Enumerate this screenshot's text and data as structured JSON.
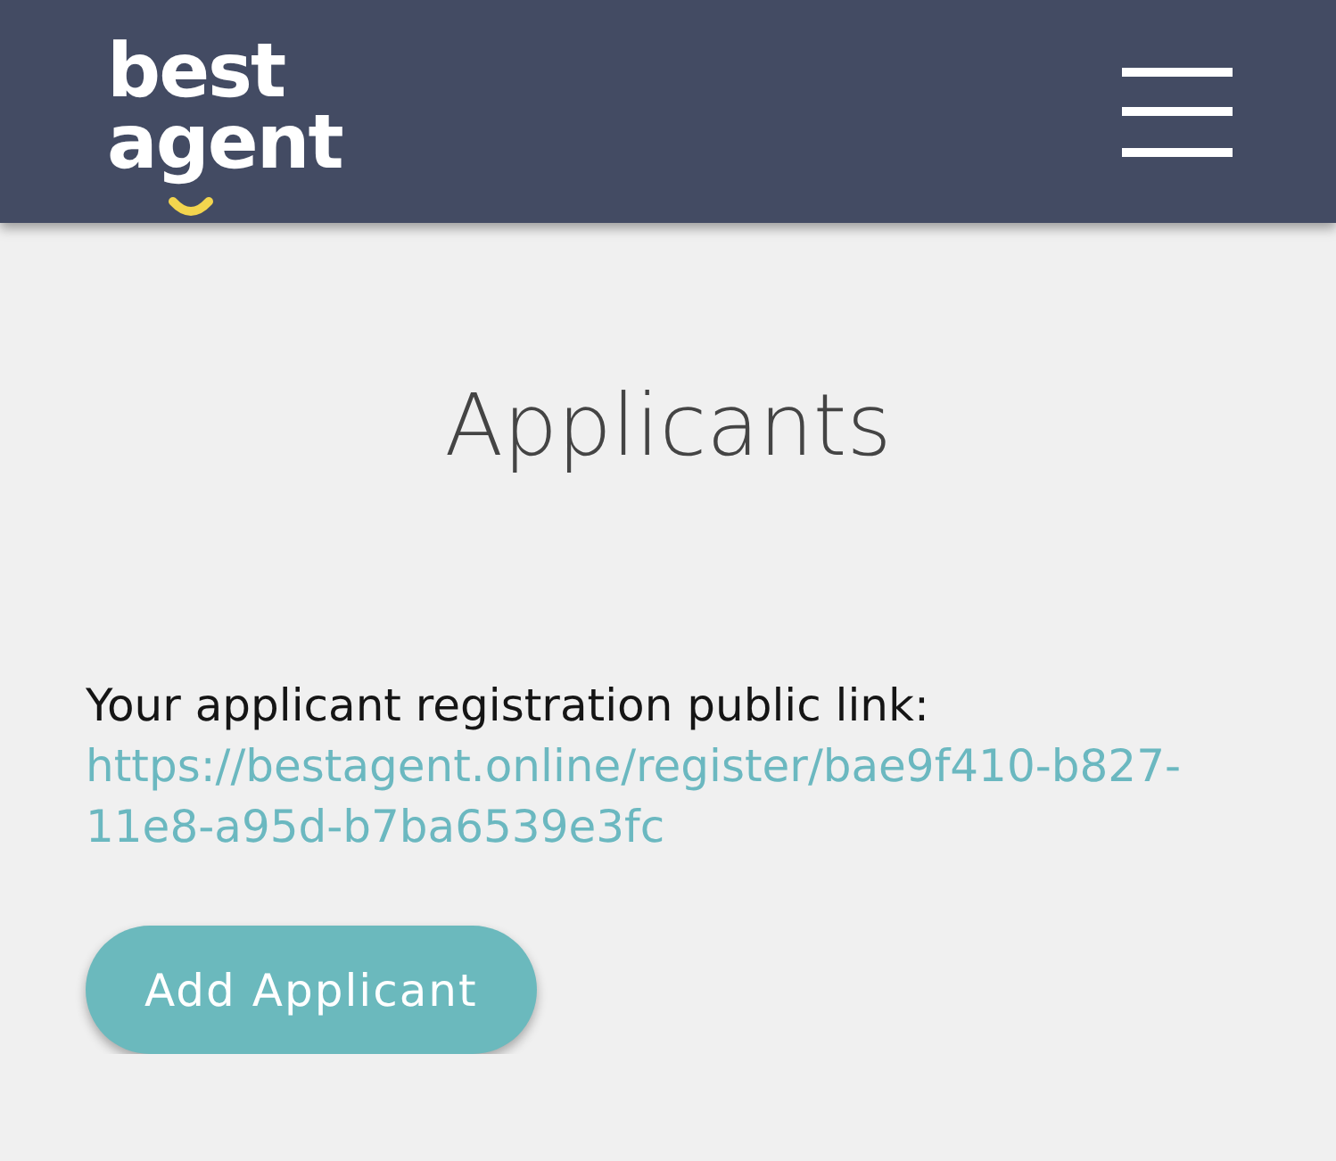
{
  "header": {
    "logo_lines": [
      "best",
      "agent"
    ]
  },
  "page": {
    "title": "Applicants",
    "link_label": "Your applicant registration public link:",
    "link": "https://bestagent.online/register/bae9f410-b827-11e8-a95d-b7ba6539e3fc",
    "button": "Add Applicant"
  }
}
